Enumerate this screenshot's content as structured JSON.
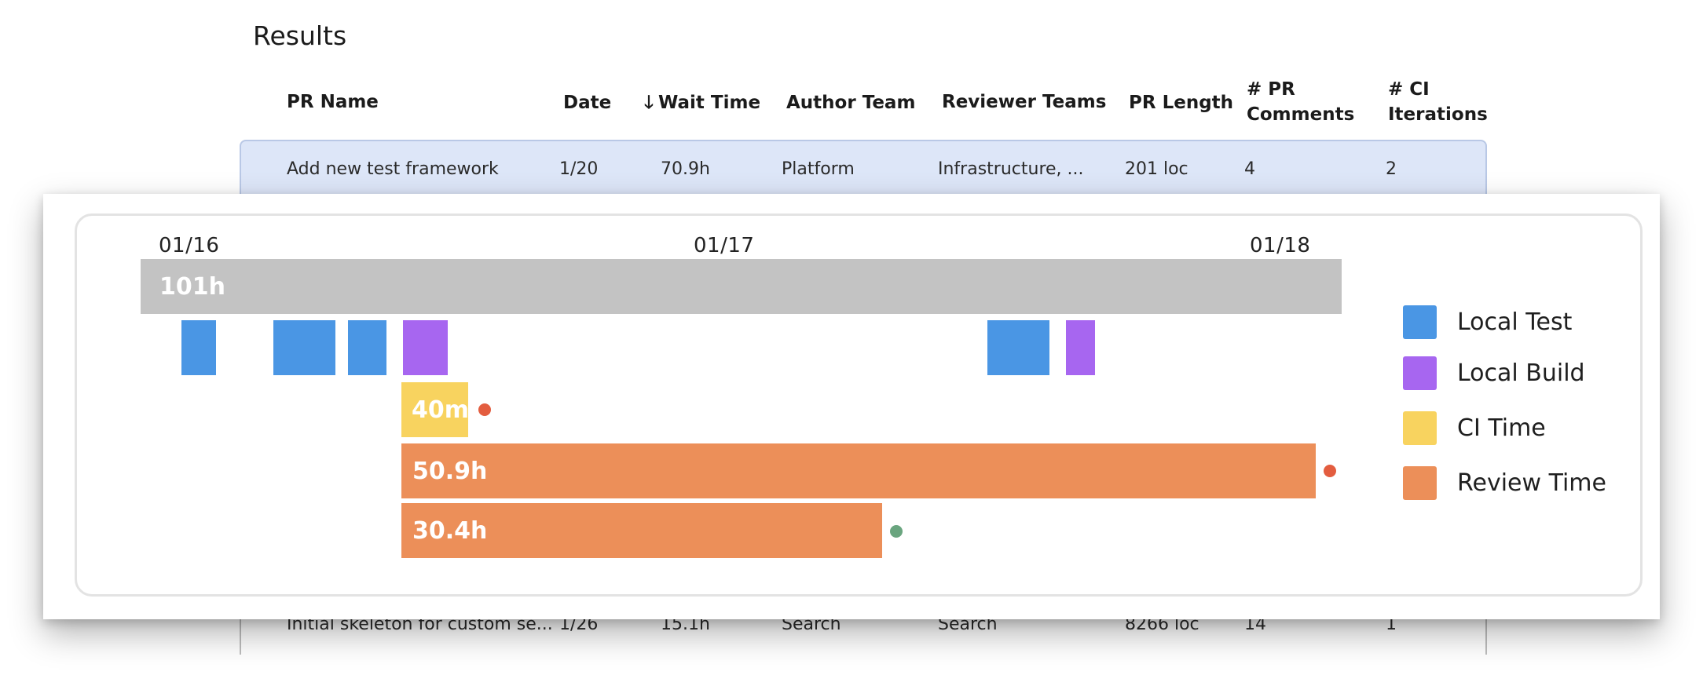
{
  "results": {
    "title": "Results",
    "headers": {
      "pr_name": "PR Name",
      "date": "Date",
      "wait_time_arrow": "🡓",
      "wait_time": "Wait Time",
      "author_team": "Author Team",
      "reviewer_teams": "Reviewer Teams",
      "pr_length": "PR Length",
      "pr_comments_1": "# PR",
      "pr_comments_2": "Comments",
      "ci_iterations_1": "# CI",
      "ci_iterations_2": "Iterations"
    },
    "rows": [
      {
        "pr_name": "Add new test framework",
        "date": "1/20",
        "wait_time": "70.9h",
        "author_team": "Platform",
        "reviewer_teams": "Infrastructure, ...",
        "pr_length": "201 loc",
        "pr_comments": "4",
        "ci_iterations": "2"
      },
      {
        "pr_name": "Initial skeleton for custom se...",
        "date": "1/26",
        "wait_time": "15.1h",
        "author_team": "Search",
        "reviewer_teams": "Search",
        "pr_length": "8266 loc",
        "pr_comments": "14",
        "ci_iterations": "1"
      }
    ]
  },
  "timeline": {
    "dates": [
      "01/16",
      "01/17",
      "01/18"
    ],
    "total_label": "101h",
    "ci_label": "40m",
    "review_labels": [
      "50.9h",
      "30.4h"
    ],
    "colors": {
      "local_test": "#4a96e4",
      "local_build": "#a766f0",
      "ci_time": "#f8d35f",
      "review_time": "#ec8f59",
      "total": "#c3c3c3",
      "dot_red": "#e35d3f",
      "dot_green": "#6aa57f"
    }
  },
  "legend": {
    "local_test": "Local Test",
    "local_build": "Local Build",
    "ci_time": "CI Time",
    "review_time": "Review Time"
  }
}
